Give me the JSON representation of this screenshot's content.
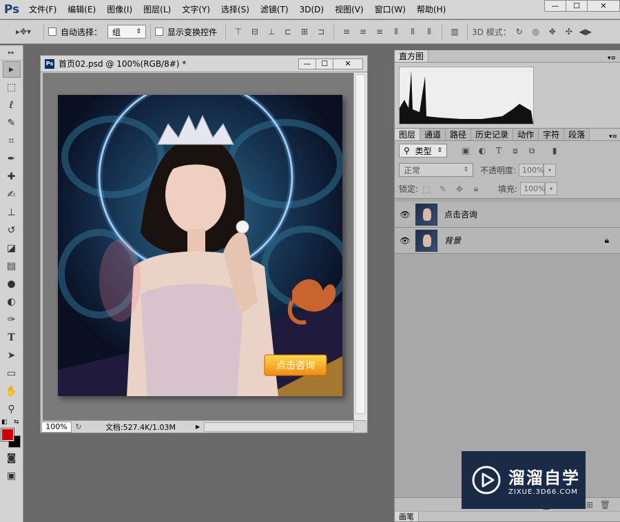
{
  "app": {
    "logo": "Ps"
  },
  "menu": [
    "文件(F)",
    "编辑(E)",
    "图像(I)",
    "图层(L)",
    "文字(Y)",
    "选择(S)",
    "滤镜(T)",
    "3D(D)",
    "视图(V)",
    "窗口(W)",
    "帮助(H)"
  ],
  "options": {
    "auto_select_label": "自动选择：",
    "auto_select_value": "组",
    "show_transform_label": "显示变换控件",
    "mode_3d_label": "3D 模式："
  },
  "document": {
    "title": "首页02.psd @ 100%(RGB/8#) *",
    "zoom": "100%",
    "doc_info": "文档:527.4K/1.03M",
    "artwork_button": "点击咨询"
  },
  "histogram": {
    "tab": "直方图"
  },
  "layers_panel": {
    "tabs": [
      "图层",
      "通道",
      "路径",
      "历史记录",
      "动作",
      "字符",
      "段落"
    ],
    "filter_kind": "类型",
    "blend_mode": "正常",
    "opacity_label": "不透明度:",
    "opacity_value": "100%",
    "lock_label": "锁定:",
    "fill_label": "填充:",
    "fill_value": "100%",
    "layers": [
      {
        "name": "点击咨询",
        "visible": true,
        "locked": false
      },
      {
        "name": "背景",
        "visible": true,
        "locked": true
      }
    ]
  },
  "bottom_panel": {
    "tab": "画笔"
  },
  "watermark": {
    "brand": "溜溜自学",
    "url": "ZIXUE.3D66.COM"
  },
  "colors": {
    "foreground": "#d40000",
    "background": "#000000",
    "accent": "#1b2a47"
  }
}
